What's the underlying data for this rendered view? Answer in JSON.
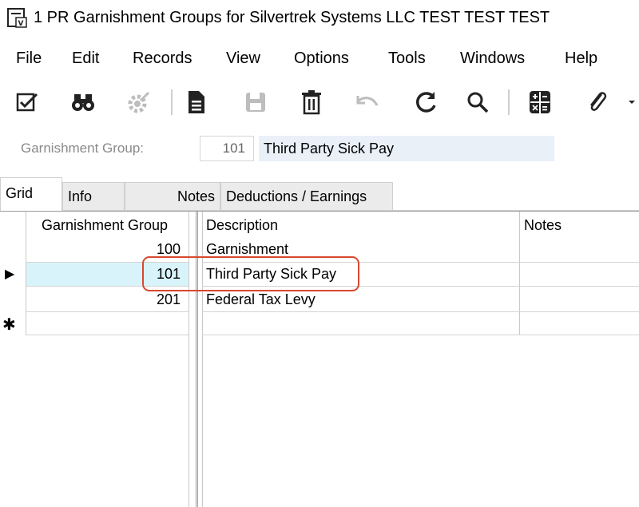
{
  "window": {
    "title": "1 PR Garnishment Groups for Silvertrek Systems LLC TEST TEST TEST"
  },
  "menu": [
    "File",
    "Edit",
    "Records",
    "View",
    "Options",
    "Tools",
    "Windows",
    "Help"
  ],
  "toolbar": {
    "icons": [
      "edit-check-icon",
      "binoculars-icon",
      "settings-gear-icon",
      "new-document-icon",
      "save-icon",
      "delete-icon",
      "undo-icon",
      "refresh-icon",
      "search-icon",
      "calculator-icon",
      "paperclip-icon",
      "dropdown-arrow-icon"
    ]
  },
  "header": {
    "label": "Garnishment Group:",
    "group_number": "101",
    "group_description": "Third Party Sick Pay"
  },
  "tabs": [
    "Grid",
    "Info",
    "Notes",
    "Deductions / Earnings"
  ],
  "grid": {
    "columns": [
      "Garnishment Group",
      "Description",
      "Notes"
    ],
    "rows": [
      {
        "group": "100",
        "description": "Garnishment",
        "notes": ""
      },
      {
        "group": "101",
        "description": "Third Party Sick Pay",
        "notes": ""
      },
      {
        "group": "201",
        "description": "Federal Tax Levy",
        "notes": ""
      }
    ],
    "current_row_marker": "▶",
    "new_row_marker": "✱"
  },
  "colors": {
    "selected_row": "#d8f4fa",
    "annotation": "#d9482f",
    "header_field_bg": "#e9f0f8"
  }
}
